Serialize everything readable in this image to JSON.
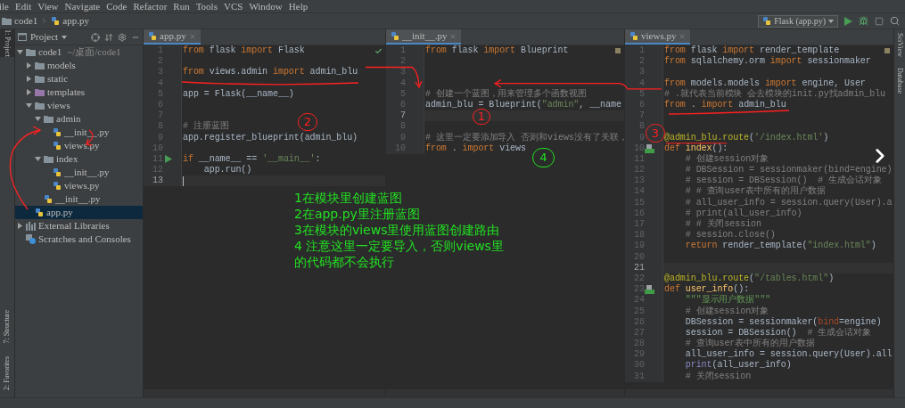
{
  "menu": [
    "ile",
    "Edit",
    "View",
    "Navigate",
    "Code",
    "Refactor",
    "Run",
    "Tools",
    "VCS",
    "Window",
    "Help"
  ],
  "breadcrumb": [
    "code1",
    "app.py"
  ],
  "run_config": {
    "label": "Flask (app.py)"
  },
  "left_strip": [
    {
      "label": "1: Project",
      "selected": true
    },
    {
      "label": "7: Structure",
      "selected": false
    },
    {
      "label": "2: Favorites",
      "selected": false
    }
  ],
  "right_strip": [
    "SciView",
    "Database"
  ],
  "project": {
    "title": "Project",
    "tree": [
      {
        "label": "code1",
        "path": "~/桌面/code1",
        "kind": "folder",
        "color": "#87939a",
        "expanded": true,
        "selected": false,
        "children": [
          {
            "label": "models",
            "kind": "folder",
            "color": "#87939a",
            "expanded": false,
            "selected": false
          },
          {
            "label": "static",
            "kind": "folder",
            "color": "#87939a",
            "expanded": false,
            "selected": false
          },
          {
            "label": "templates",
            "kind": "folder",
            "color": "#9876aa",
            "expanded": false,
            "selected": false
          },
          {
            "label": "views",
            "kind": "folder",
            "color": "#87939a",
            "expanded": true,
            "selected": false,
            "children": [
              {
                "label": "admin",
                "kind": "folder",
                "color": "#87939a",
                "expanded": true,
                "selected": false,
                "children": [
                  {
                    "label": "__init__.py",
                    "kind": "python",
                    "selected": false
                  },
                  {
                    "label": "views.py",
                    "kind": "python",
                    "selected": false
                  }
                ]
              },
              {
                "label": "index",
                "kind": "folder",
                "color": "#87939a",
                "expanded": true,
                "selected": false,
                "children": [
                  {
                    "label": "__init__.py",
                    "kind": "python",
                    "selected": false
                  },
                  {
                    "label": "views.py",
                    "kind": "python",
                    "selected": false
                  }
                ]
              },
              {
                "label": "__init__.py",
                "kind": "python",
                "selected": false
              }
            ]
          },
          {
            "label": "app.py",
            "kind": "python",
            "selected": true
          }
        ]
      },
      {
        "label": "External Libraries",
        "kind": "library",
        "expanded": false,
        "selected": false
      },
      {
        "label": "Scratches and Consoles",
        "kind": "scratch",
        "selected": false
      }
    ]
  },
  "editors": [
    {
      "tab": "app.py",
      "focused": true,
      "inspection_passed": true,
      "lines": [
        {
          "number": "1",
          "current": false,
          "tokens": [
            {
              "kind": "kw",
              "text": "from"
            },
            {
              "kind": "id",
              "text": " flask "
            },
            {
              "kind": "kw",
              "text": "import"
            },
            {
              "kind": "id",
              "text": " Flask"
            }
          ]
        },
        {
          "number": "2",
          "current": false
        },
        {
          "number": "3",
          "current": false,
          "tokens": [
            {
              "kind": "kw",
              "text": "from"
            },
            {
              "kind": "id",
              "text": " views.admin "
            },
            {
              "kind": "kw",
              "text": "import"
            },
            {
              "kind": "id",
              "text": " admin_blu"
            }
          ]
        },
        {
          "number": "4",
          "current": false
        },
        {
          "number": "5",
          "current": false,
          "tokens": [
            {
              "kind": "id",
              "text": "app = Flask(__name__)"
            }
          ]
        },
        {
          "number": "6",
          "current": false
        },
        {
          "number": "7",
          "current": false
        },
        {
          "number": "8",
          "current": false,
          "tokens": [
            {
              "kind": "cmt",
              "text": "# 注册蓝图"
            }
          ]
        },
        {
          "number": "9",
          "current": false,
          "tokens": [
            {
              "kind": "id",
              "text": "app.register_blueprint(admin_blu)"
            }
          ]
        },
        {
          "number": "10",
          "current": false
        },
        {
          "number": "11",
          "current": false,
          "run": true,
          "tokens": [
            {
              "kind": "kw",
              "text": "if"
            },
            {
              "kind": "id",
              "text": " __name__ == "
            },
            {
              "kind": "str",
              "text": "'__main__'"
            },
            {
              "kind": "id",
              "text": ":"
            }
          ]
        },
        {
          "number": "12",
          "current": false,
          "tokens": [
            {
              "kind": "id",
              "text": "    app.run()"
            }
          ]
        },
        {
          "number": "13",
          "current": true
        }
      ]
    },
    {
      "tab": "__init__.py",
      "focused": false,
      "inspection_passed": false,
      "lines": [
        {
          "number": "1",
          "current": false,
          "tokens": [
            {
              "kind": "kw",
              "text": "from"
            },
            {
              "kind": "id",
              "text": " flask "
            },
            {
              "kind": "kw",
              "text": "import"
            },
            {
              "kind": "id",
              "text": " Blueprint"
            }
          ]
        },
        {
          "number": "2",
          "current": false
        },
        {
          "number": "3",
          "current": false
        },
        {
          "number": "4",
          "current": false
        },
        {
          "number": "5",
          "current": false,
          "tokens": [
            {
              "kind": "cmt",
              "text": "# 创建一个蓝图，用来管理多个函数视图"
            }
          ]
        },
        {
          "number": "6",
          "current": false,
          "tokens": [
            {
              "kind": "id",
              "text": "admin_blu = Blueprint("
            },
            {
              "kind": "str",
              "text": "\"admin\""
            },
            {
              "kind": "id",
              "text": ", __name"
            }
          ]
        },
        {
          "number": "7",
          "current": true
        },
        {
          "number": "8",
          "current": false
        },
        {
          "number": "9",
          "current": false,
          "tokens": [
            {
              "kind": "cmt",
              "text": "# 这里一定要添加导入 否则和views没有了关联，"
            }
          ]
        },
        {
          "number": "10",
          "current": false,
          "tokens": [
            {
              "kind": "kw",
              "text": "from"
            },
            {
              "kind": "id",
              "text": " . "
            },
            {
              "kind": "kw",
              "text": "import"
            },
            {
              "kind": "id",
              "text": " views"
            }
          ]
        }
      ]
    },
    {
      "tab": "views.py",
      "focused": false,
      "inspection_passed": false,
      "lines": [
        {
          "number": "1",
          "current": false,
          "tokens": [
            {
              "kind": "kw",
              "text": "from"
            },
            {
              "kind": "id",
              "text": " flask "
            },
            {
              "kind": "kw",
              "text": "import"
            },
            {
              "kind": "id",
              "text": " render_template"
            }
          ]
        },
        {
          "number": "2",
          "current": false,
          "tokens": [
            {
              "kind": "kw",
              "text": "from"
            },
            {
              "kind": "id",
              "text": " sqlalchemy.orm "
            },
            {
              "kind": "kw",
              "text": "import"
            },
            {
              "kind": "id",
              "text": " sessionmaker"
            }
          ]
        },
        {
          "number": "3",
          "current": false
        },
        {
          "number": "4",
          "current": false,
          "tokens": [
            {
              "kind": "kw",
              "text": "from"
            },
            {
              "kind": "id",
              "text": " models.models "
            },
            {
              "kind": "kw",
              "text": "import"
            },
            {
              "kind": "id",
              "text": " engine, User"
            }
          ]
        },
        {
          "number": "5",
          "current": false,
          "tokens": [
            {
              "kind": "cmt",
              "text": "# .就代表当前模块 会去模块的init.py找admin_blu"
            }
          ]
        },
        {
          "number": "6",
          "current": false,
          "tokens": [
            {
              "kind": "kw",
              "text": "from"
            },
            {
              "kind": "id",
              "text": " . "
            },
            {
              "kind": "kw",
              "text": "import"
            },
            {
              "kind": "id",
              "text": " admin_blu"
            }
          ]
        },
        {
          "number": "7",
          "current": false
        },
        {
          "number": "8",
          "current": false
        },
        {
          "number": "9",
          "current": false,
          "tokens": [
            {
              "kind": "dec",
              "text": "@admin_blu.route"
            },
            {
              "kind": "id",
              "text": "("
            },
            {
              "kind": "str",
              "text": "'/index.html'"
            },
            {
              "kind": "id",
              "text": ")"
            }
          ]
        },
        {
          "number": "10",
          "current": false,
          "route": true,
          "tokens": [
            {
              "kind": "kw",
              "text": "def"
            },
            {
              "kind": "fn",
              "text": " index"
            },
            {
              "kind": "id",
              "text": "():"
            }
          ]
        },
        {
          "number": "11",
          "current": false,
          "tokens": [
            {
              "kind": "cmt",
              "text": "    # 创建session对象"
            }
          ]
        },
        {
          "number": "12",
          "current": false,
          "tokens": [
            {
              "kind": "cmt",
              "text": "    # DBSession = sessionmaker(bind=engine)"
            }
          ]
        },
        {
          "number": "13",
          "current": false,
          "tokens": [
            {
              "kind": "cmt",
              "text": "    # session = DBSession()  # 生成会话对象"
            }
          ]
        },
        {
          "number": "14",
          "current": false,
          "tokens": [
            {
              "kind": "cmt",
              "text": "    # # 查询user表中所有的用户数据"
            }
          ]
        },
        {
          "number": "15",
          "current": false,
          "tokens": [
            {
              "kind": "cmt",
              "text": "    # all_user_info = session.query(User).a"
            }
          ]
        },
        {
          "number": "16",
          "current": false,
          "tokens": [
            {
              "kind": "cmt",
              "text": "    # print(all_user_info)"
            }
          ]
        },
        {
          "number": "17",
          "current": false,
          "tokens": [
            {
              "kind": "cmt",
              "text": "    # # 关闭session"
            }
          ]
        },
        {
          "number": "18",
          "current": false,
          "tokens": [
            {
              "kind": "cmt",
              "text": "    # session.close()"
            }
          ]
        },
        {
          "number": "19",
          "current": false,
          "tokens": [
            {
              "kind": "kw",
              "text": "    return"
            },
            {
              "kind": "id",
              "text": " render_template("
            },
            {
              "kind": "str",
              "text": "\"index.html\""
            },
            {
              "kind": "id",
              "text": ")"
            }
          ]
        },
        {
          "number": "20",
          "current": false
        },
        {
          "number": "21",
          "current": true
        },
        {
          "number": "22",
          "current": false,
          "tokens": [
            {
              "kind": "dec",
              "text": "@admin_blu.route"
            },
            {
              "kind": "id",
              "text": "("
            },
            {
              "kind": "str",
              "text": "\"/tables.html\""
            },
            {
              "kind": "id",
              "text": ")"
            }
          ]
        },
        {
          "number": "23",
          "current": false,
          "route": true,
          "tokens": [
            {
              "kind": "kw",
              "text": "def"
            },
            {
              "kind": "fn",
              "text": " user_info"
            },
            {
              "kind": "id",
              "text": "():"
            }
          ]
        },
        {
          "number": "24",
          "current": false,
          "tokens": [
            {
              "kind": "doc",
              "text": "    \"\"\"显示用户数据\"\"\""
            }
          ]
        },
        {
          "number": "25",
          "current": false,
          "tokens": [
            {
              "kind": "cmt",
              "text": "    # 创建session对象"
            }
          ]
        },
        {
          "number": "26",
          "current": false,
          "tokens": [
            {
              "kind": "id",
              "text": "    DBSession = sessionmaker("
            },
            {
              "kind": "par",
              "text": "bind"
            },
            {
              "kind": "id",
              "text": "=engine)"
            }
          ]
        },
        {
          "number": "27",
          "current": false,
          "tokens": [
            {
              "kind": "id",
              "text": "    session = DBSession()  "
            },
            {
              "kind": "cmt",
              "text": "# 生成会话对象"
            }
          ]
        },
        {
          "number": "28",
          "current": false,
          "tokens": [
            {
              "kind": "cmt",
              "text": "    # 查询user表中所有的用户数据"
            }
          ]
        },
        {
          "number": "29",
          "current": false,
          "tokens": [
            {
              "kind": "id",
              "text": "    all_user_info = session.query(User).all"
            }
          ]
        },
        {
          "number": "30",
          "current": false,
          "tokens": [
            {
              "kind": "bi",
              "text": "    print"
            },
            {
              "kind": "id",
              "text": "(all_user_info)"
            }
          ]
        },
        {
          "number": "31",
          "current": false,
          "tokens": [
            {
              "kind": "cmt",
              "text": "    # 关闭session"
            }
          ]
        }
      ]
    }
  ],
  "annotations": {
    "note": [
      "1在模块里创建蓝图",
      "2在app.py里注册蓝图",
      "3在模块的views里使用蓝图创建路由",
      "4 注意这里一定要导入，否则views里",
      "的代码都不会执行"
    ],
    "circled_numbers": [
      {
        "text": "2",
        "color": "#ff2020"
      },
      {
        "text": "1",
        "color": "#ff2020"
      },
      {
        "text": "3",
        "color": "#ff2020"
      },
      {
        "text": "4",
        "color": "#20e020"
      }
    ]
  }
}
